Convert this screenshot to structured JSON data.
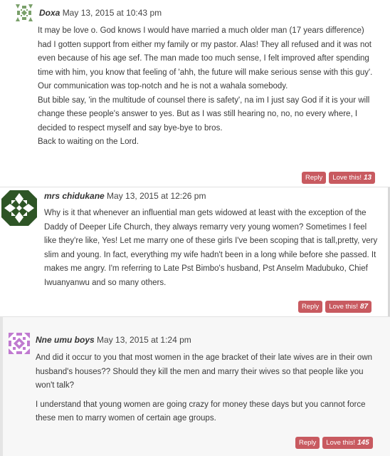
{
  "colors": {
    "button_bg": "#c85a60",
    "button_text": "#ffffff",
    "text": "#333333",
    "alt_row_bg": "#f7f7f7"
  },
  "comments": [
    {
      "author": "Doxa",
      "date": "May 13, 2015 at 10:43 pm",
      "avatar": "identicon-avatar",
      "paragraphs": [
        "It may be love o. God knows I would have married a much older man (17 years difference) had I gotten support from either my family or my pastor. Alas! They all refused and it was not even because of his age sef. The man made too much sense, I felt improved after spending time with him, you know that feeling of 'ahh, the future will make serious sense with this guy'. Our communication was top-notch and he is not a wahala somebody.\nBut bible say, 'in the multitude of counsel there is safety', na im I just say God if it is your will change these people's answer to yes. But as I was still hearing no, no, no every where, I decided to respect myself and say bye-bye to bros.\nBack to waiting on the Lord."
      ],
      "reply_label": "Reply",
      "love_label": "Love this!",
      "love_count": "13"
    },
    {
      "author": "mrs chidukane",
      "date": "May 13, 2015 at 12:26 pm",
      "avatar": "identicon-avatar",
      "paragraphs": [
        "Why is it that whenever an influential man gets widowed at least with the exception of the Daddy of Deeper Life Church, they always remarry very young women? Sometimes I feel like they're like, Yes! Let me marry one of these girls I've been scoping that is tall,pretty, very slim and young. In fact, everything my wife hadn't been in a long while before she passed. It makes me angry. I'm referring to Late Pst Bimbo's husband, Pst Anselm Madubuko, Chief Iwuanyanwu and so many others."
      ],
      "reply_label": "Reply",
      "love_label": "Love this!",
      "love_count": "87"
    },
    {
      "author": "Nne umu boys",
      "date": "May 13, 2015 at 1:24 pm",
      "avatar": "identicon-avatar",
      "paragraphs": [
        "And did it occur to you that most women in the age bracket of their late wives are in their own husband's houses?? Should they kill the men and marry their wives so that people like you won't talk?",
        "I understand that young women are going crazy for money these days but you cannot force these men to marry women of certain age groups."
      ],
      "reply_label": "Reply",
      "love_label": "Love this!",
      "love_count": "145"
    }
  ]
}
